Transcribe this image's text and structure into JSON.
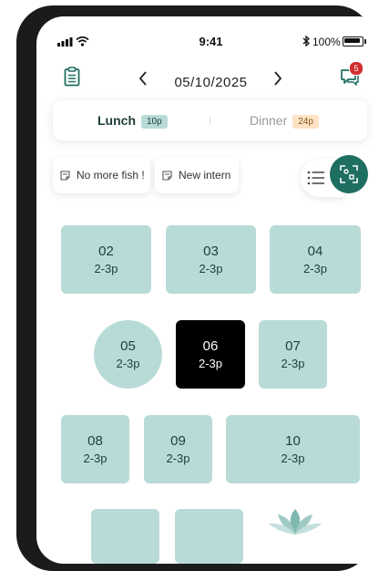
{
  "status_bar": {
    "time": "9:41",
    "battery": "100%"
  },
  "header": {
    "date": "05/10/2025",
    "messages_badge": "5"
  },
  "tabs": [
    {
      "label": "Lunch",
      "count": "10p",
      "active": true
    },
    {
      "label": "Dinner",
      "count": "24p",
      "active": false
    }
  ],
  "notes": [
    {
      "label": "No more fish !"
    },
    {
      "label": "New intern"
    }
  ],
  "tables": [
    {
      "num": "02",
      "capacity": "2-3p"
    },
    {
      "num": "03",
      "capacity": "2-3p"
    },
    {
      "num": "04",
      "capacity": "2-3p"
    },
    {
      "num": "05",
      "capacity": "2-3p"
    },
    {
      "num": "06",
      "capacity": "2-3p",
      "selected": true
    },
    {
      "num": "07",
      "capacity": "2-3p"
    },
    {
      "num": "08",
      "capacity": "2-3p"
    },
    {
      "num": "09",
      "capacity": "2-3p"
    },
    {
      "num": "10",
      "capacity": "2-3p"
    }
  ],
  "colors": {
    "accent": "#1f6e62",
    "table": "#b9dbd8",
    "lunch_pill": "#b9dbd8",
    "dinner_pill": "#fde3c4",
    "badge": "#d32f2f"
  }
}
